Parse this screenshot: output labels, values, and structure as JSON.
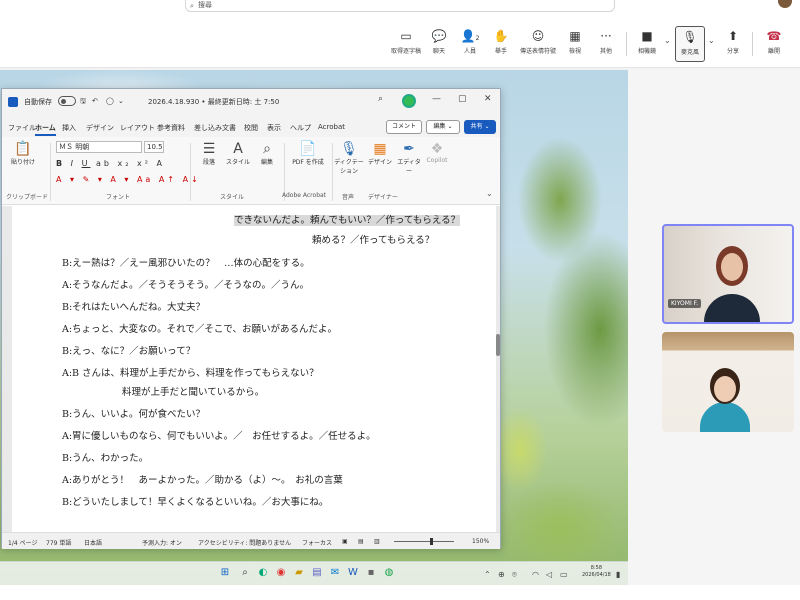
{
  "teams": {
    "search_placeholder": "搜尋",
    "toolbar": {
      "record_label": "取得逐字稿",
      "chat_label": "聊天",
      "people_label": "人員",
      "people_count": "2",
      "raise_label": "舉手",
      "react_label": "傳送表情符號",
      "view_label": "檢視",
      "more_label": "其他",
      "camera_label": "相機鏡",
      "mic_label": "麥克風",
      "share_label": "分享",
      "leave_label": "離開"
    },
    "participants": [
      {
        "name": "KIYOMI F."
      },
      {
        "name": ""
      }
    ]
  },
  "word": {
    "autosave_label": "自動保存",
    "autosave_state": "オフ",
    "file_title": "2026.4.18.930 • 最終更新日時: 土 7:50",
    "menu": [
      "ファイル",
      "ホーム",
      "挿入",
      "デザイン",
      "レイアウト",
      "参考資料",
      "差し込み文書",
      "校閲",
      "表示",
      "ヘルプ",
      "Acrobat"
    ],
    "menu_selected_index": 1,
    "comment_label": "コメント",
    "edit_label": "編集",
    "share_label": "共有",
    "ribbon": {
      "paste_label": "貼り付け",
      "clipboard_group": "クリップボード",
      "font_name": "ＭＳ 明朝",
      "font_size": "10.5",
      "font_group": "フォント",
      "paragraph_label": "段落",
      "style_label": "スタイル",
      "style_group": "スタイル",
      "edit_label": "編集",
      "pdf_label": "PDF を作成",
      "acrobat_group": "Adobe Acrobat",
      "dictation_label": "ディクテーション",
      "voice_group": "音声",
      "design_label": "デザイン",
      "designer_group": "デザイナー",
      "editor_label": "エディター",
      "copilot_label": "Copilot"
    },
    "document_lines": [
      "できないんだよ。頼んでもいい？／作ってもらえる？",
      "頼める？／作ってもらえる？",
      "B:えー熱は？／えー風邪ひいたの？　…体の心配をする。",
      "A:そうなんだよ。／そうそうそう。／そうなの。／うん。",
      "B:それはたいへんだね。大丈夫？",
      "A:ちょっと、大変なの。それで／そこで、お願いがあるんだよ。",
      "B:えっ、なに？／お願いって？",
      "A:B さんは、料理が上手だから、料理を作ってもらえない？",
      "料理が上手だと聞いているから。",
      "B:うん、いいよ。何が食べたい？",
      "A:胃に優しいものなら、何でもいいよ。／　お任せするよ。／任せるよ。",
      "B:うん、わかった。",
      "A:ありがとう！　あーよかった。／助かる（よ）～。　お礼の言葉",
      "B:どういたしまして！早くよくなるといいね。／お大事にね。"
    ],
    "status": {
      "page": "1/4 ページ",
      "words": "779 単語",
      "language": "日本語",
      "predict": "予測入力: オン",
      "accessibility": "アクセシビリティ: 問題ありません",
      "focus": "フォーカス",
      "zoom": "150%"
    }
  },
  "taskbar": {
    "time": "8:58",
    "date": "2026/04/18"
  }
}
